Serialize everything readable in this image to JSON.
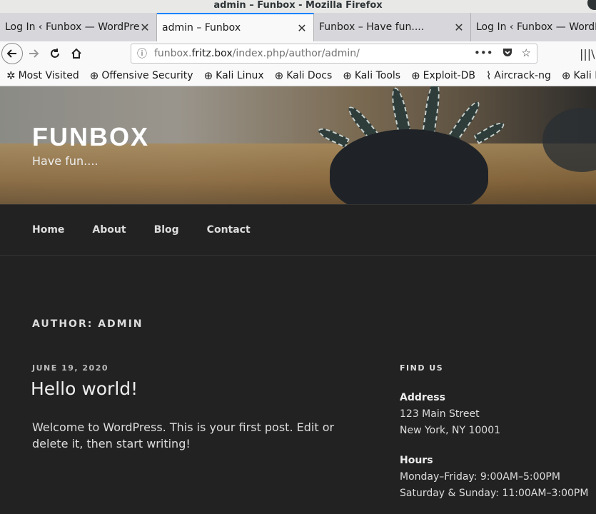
{
  "window": {
    "title": "admin – Funbox - Mozilla Firefox"
  },
  "tabs": [
    {
      "title": "Log In ‹ Funbox — WordPress",
      "active": false
    },
    {
      "title": "admin – Funbox",
      "active": true
    },
    {
      "title": "Funbox – Have fun....",
      "active": false
    },
    {
      "title": "Log In ‹ Funbox — WordPress",
      "active": false
    }
  ],
  "urlbar": {
    "host": "funbox.fritz.box",
    "path": "/index.php/author/admin/"
  },
  "bookmarks": [
    {
      "label": "Most Visited",
      "icon": "gear-icon"
    },
    {
      "label": "Offensive Security",
      "icon": "globe-icon"
    },
    {
      "label": "Kali Linux",
      "icon": "globe-icon"
    },
    {
      "label": "Kali Docs",
      "icon": "globe-icon"
    },
    {
      "label": "Kali Tools",
      "icon": "globe-icon"
    },
    {
      "label": "Exploit-DB",
      "icon": "globe-icon"
    },
    {
      "label": "Aircrack-ng",
      "icon": "aircrack-icon"
    },
    {
      "label": "Kali Fo",
      "icon": "globe-icon"
    }
  ],
  "site": {
    "title": "FUNBOX",
    "tagline": "Have fun...."
  },
  "nav": [
    "Home",
    "About",
    "Blog",
    "Contact"
  ],
  "archive": {
    "title": "AUTHOR: ADMIN"
  },
  "post": {
    "date": "JUNE 19, 2020",
    "title": "Hello world!",
    "excerpt": "Welcome to WordPress. This is your first post. Edit or delete it, then start writing!"
  },
  "widget": {
    "title": "FIND US",
    "address_label": "Address",
    "address_line1": "123 Main Street",
    "address_line2": "New York, NY 10001",
    "hours_label": "Hours",
    "hours_line1": "Monday–Friday: 9:00AM–5:00PM",
    "hours_line2": "Saturday & Sunday: 11:00AM–3:00PM"
  }
}
